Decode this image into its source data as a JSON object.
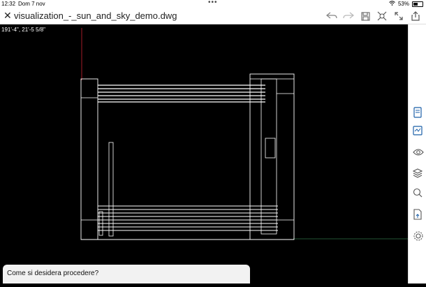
{
  "status": {
    "time": "12:32",
    "date": "Dom 7 nov",
    "battery": "53%"
  },
  "title": {
    "filename": "visualization_-_sun_and_sky_demo.dwg"
  },
  "toolbar": {
    "icons": [
      "undo-icon",
      "redo-icon",
      "save-icon",
      "trim-icon",
      "fullscreen-icon",
      "share-icon"
    ]
  },
  "canvas": {
    "coords": "191'-4\",  21'-5 5/8\""
  },
  "rightbar": {
    "icons": [
      "properties-icon",
      "markup-icon",
      "view-icon",
      "layers-icon",
      "measure-icon",
      "export-icon",
      "settings-icon"
    ]
  },
  "prompt": {
    "text": "Come si desidera procedere?"
  }
}
